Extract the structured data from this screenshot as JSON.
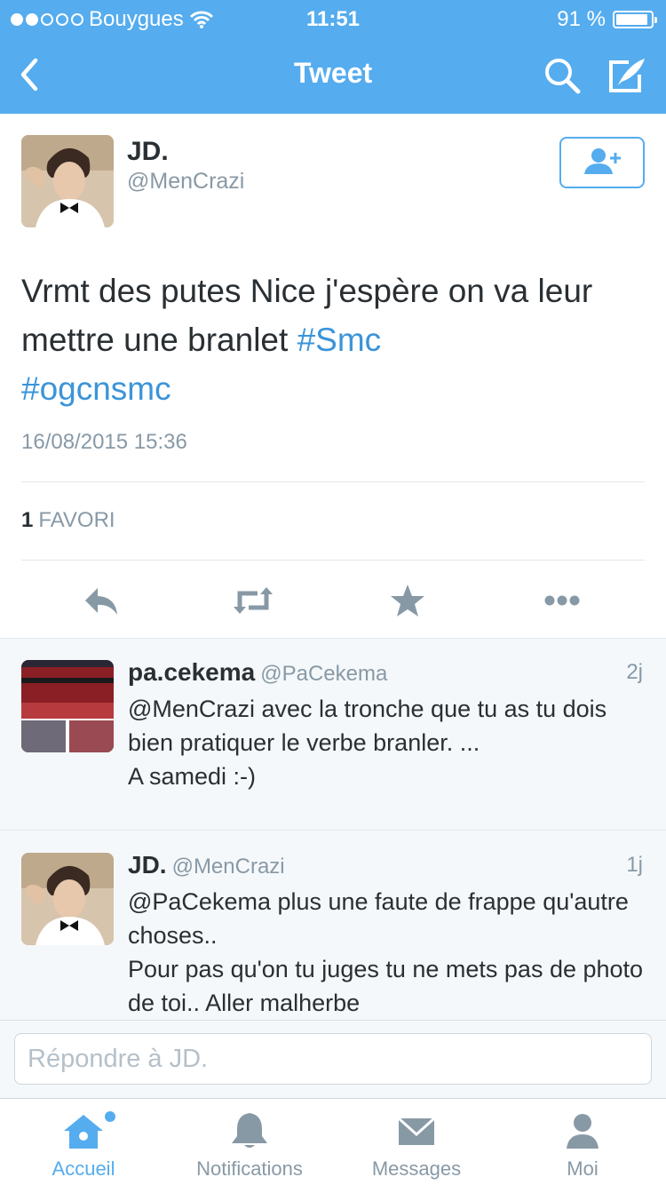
{
  "status_bar": {
    "carrier": "Bouygues",
    "time": "11:51",
    "battery": "91 %",
    "battery_level": 0.91
  },
  "nav": {
    "title": "Tweet",
    "icons": [
      "chevron-left-icon",
      "search-icon",
      "compose-icon"
    ]
  },
  "tweet": {
    "author_name": "JD.",
    "author_handle": "@MenCrazi",
    "text_before": "Vrmt des putes Nice j'espère on va leur mettre une branlet ",
    "hashtag1": "#Smc",
    "hashtag2": "#ogcnsmc",
    "date": "16/08/2015 15:36",
    "favorites_count": "1",
    "favorites_label": "FAVORI"
  },
  "replies": [
    {
      "name": "pa.cekema",
      "handle": "@PaCekema",
      "time": "2j",
      "text": "@MenCrazi avec la tronche que tu as tu dois bien pratiquer le verbe branler. ...\nA samedi :-)"
    },
    {
      "name": "JD.",
      "handle": "@MenCrazi",
      "time": "1j",
      "text": "@PaCekema plus une faute de frappe qu'autre choses..\nPour pas qu'on tu juges tu ne mets pas de photo de toi.. Aller malherbe"
    }
  ],
  "reply_bar": {
    "placeholder": "Répondre à JD."
  },
  "tabs": [
    {
      "label": "Accueil",
      "icon": "home-icon",
      "active": true
    },
    {
      "label": "Notifications",
      "icon": "bell-icon",
      "active": false
    },
    {
      "label": "Messages",
      "icon": "envelope-icon",
      "active": false
    },
    {
      "label": "Moi",
      "icon": "person-icon",
      "active": false
    }
  ],
  "colors": {
    "brand": "#55acee",
    "link": "#3b94d9",
    "muted": "#8899a6"
  }
}
